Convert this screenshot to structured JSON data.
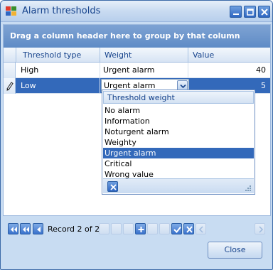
{
  "window": {
    "title": "Alarm thresholds",
    "controls": [
      "minimize",
      "maximize",
      "close"
    ]
  },
  "grid": {
    "group_panel_text": "Drag a column header here to group by that column",
    "columns": [
      "Threshold type",
      "Weight",
      "Value"
    ],
    "rows": [
      {
        "threshold_type": "High",
        "weight": "Urgent alarm",
        "value": "40"
      },
      {
        "threshold_type": "Low",
        "weight": "Urgent alarm",
        "value": "5"
      }
    ],
    "selected_row": 2,
    "editing_row_icon": "pencil-icon"
  },
  "weight_editor": {
    "value": "Urgent alarm"
  },
  "dropdown": {
    "header": "Threshold weight",
    "options": [
      "No alarm",
      "Information",
      "Noturgent alarm",
      "Weighty",
      "Urgent alarm",
      "Critical",
      "Wrong value"
    ],
    "selected": "Urgent alarm"
  },
  "navigator": {
    "record_text": "Record 2 of 2",
    "buttons": [
      "first",
      "prev-page",
      "prev",
      "next",
      "next-page",
      "last",
      "append",
      "delete",
      "edit",
      "end-edit",
      "cancel-edit",
      "scroll-left",
      "scroll-right"
    ]
  },
  "footer": {
    "close_label": "Close"
  },
  "colors": {
    "title_text": "#15428b",
    "selection": "#3369ba",
    "group_panel": "#6f96cc"
  }
}
